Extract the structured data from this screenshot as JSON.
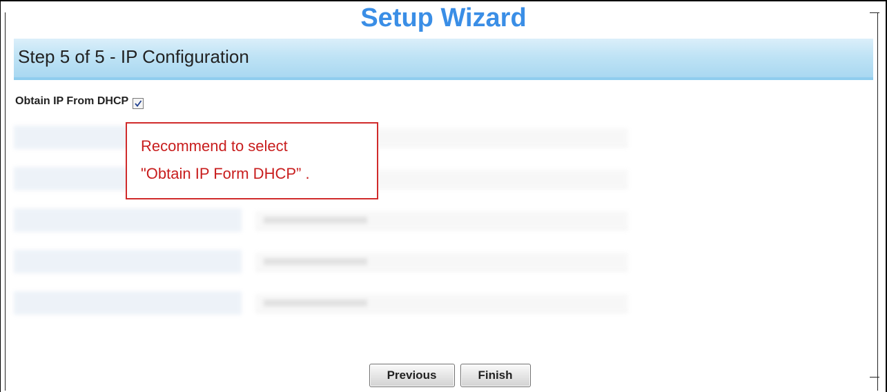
{
  "wizard": {
    "title": "Setup Wizard",
    "step_title": "Step 5 of 5 - IP Configuration"
  },
  "dhcp": {
    "label": "Obtain IP From DHCP",
    "checked": true
  },
  "callout": {
    "line1": "Recommend to select",
    "line2": "\"Obtain IP Form DHCP” ."
  },
  "buttons": {
    "previous_label": "Previous",
    "finish_label": "Finish"
  },
  "colors": {
    "title": "#3a8ee6",
    "step_bar": "#bfe3f5",
    "callout_border": "#d02a2a",
    "callout_text": "#c81d1d"
  },
  "icons": {
    "checkbox": "check-icon"
  }
}
